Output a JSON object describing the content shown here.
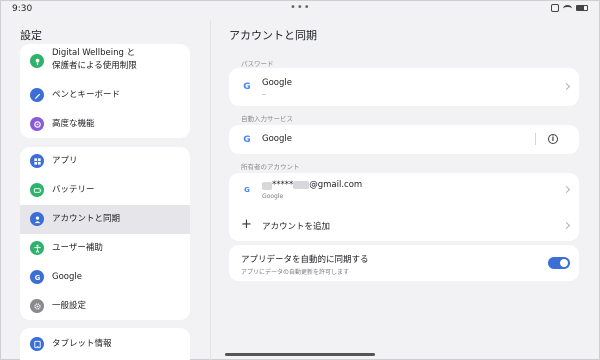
{
  "statusbar": {
    "time": "9:30",
    "dots": "•••"
  },
  "left": {
    "title": "設定",
    "card1": [
      {
        "label_line1": "Digital Wellbeing と",
        "label_line2": "保護者による使用制限",
        "icon": "wellbeing-icon",
        "color": "#2fb36b"
      },
      {
        "label": "ペンとキーボード",
        "icon": "pen-icon",
        "color": "#3b6fd6"
      },
      {
        "label": "高度な機能",
        "icon": "advanced-icon",
        "color": "#8a5bd6"
      }
    ],
    "card2": [
      {
        "label": "アプリ",
        "icon": "apps-icon",
        "color": "#3b6fd6"
      },
      {
        "label": "バッテリー",
        "icon": "battery-icon",
        "color": "#2fb36b"
      },
      {
        "label": "アカウントと同期",
        "icon": "account-icon",
        "color": "#3b6fd6",
        "active": true
      },
      {
        "label": "ユーザー補助",
        "icon": "accessibility-icon",
        "color": "#2fb36b"
      },
      {
        "label": "Google",
        "icon": "google-icon",
        "color": "#3b6fd6"
      },
      {
        "label": "一般設定",
        "icon": "general-settings-icon",
        "color": "#8a8a8e"
      }
    ],
    "card3": [
      {
        "label": "タブレット情報",
        "icon": "tablet-info-icon",
        "color": "#3b6fd6"
      }
    ]
  },
  "right": {
    "title": "アカウントと同期",
    "password_section": "パスワード",
    "password_item": {
      "title": "Google",
      "sub": "--"
    },
    "autofill_section": "自動入力サービス",
    "autofill_item": {
      "title": "Google"
    },
    "owner_section": "所有者のアカウント",
    "account_item": {
      "email_masked": "*****",
      "email_domain": "@gmail.com",
      "sub": "Google"
    },
    "add_account": "アカウントを追加",
    "sync": {
      "title": "アプリデータを自動的に同期する",
      "sub": "アプリにデータの自動更新を許可します",
      "enabled": true
    }
  },
  "colors": {
    "accent": "#3b6fd6",
    "google_blue": "#4285f4"
  }
}
